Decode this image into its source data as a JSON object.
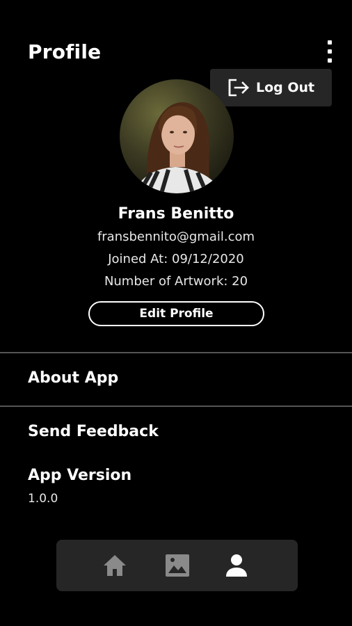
{
  "header": {
    "title": "Profile",
    "more_icon": "more-vertical-icon"
  },
  "logout_menu": {
    "label": "Log Out",
    "icon": "logout-icon"
  },
  "profile": {
    "name": "Frans Benitto",
    "email": "fransbennito@gmail.com",
    "joined": "Joined At: 09/12/2020",
    "artwork_count": "Number of Artwork: 20",
    "edit_label": "Edit Profile"
  },
  "menu": {
    "about": "About App",
    "feedback": "Send Feedback",
    "version_label": "App Version",
    "version_value": "1.0.0"
  },
  "bottom_nav": {
    "items": [
      {
        "icon": "home-icon",
        "active": false
      },
      {
        "icon": "gallery-icon",
        "active": false
      },
      {
        "icon": "profile-icon",
        "active": true
      }
    ]
  },
  "colors": {
    "background": "#000000",
    "surface": "#262626",
    "text": "#ffffff",
    "inactive_icon": "#8a8a8a"
  }
}
